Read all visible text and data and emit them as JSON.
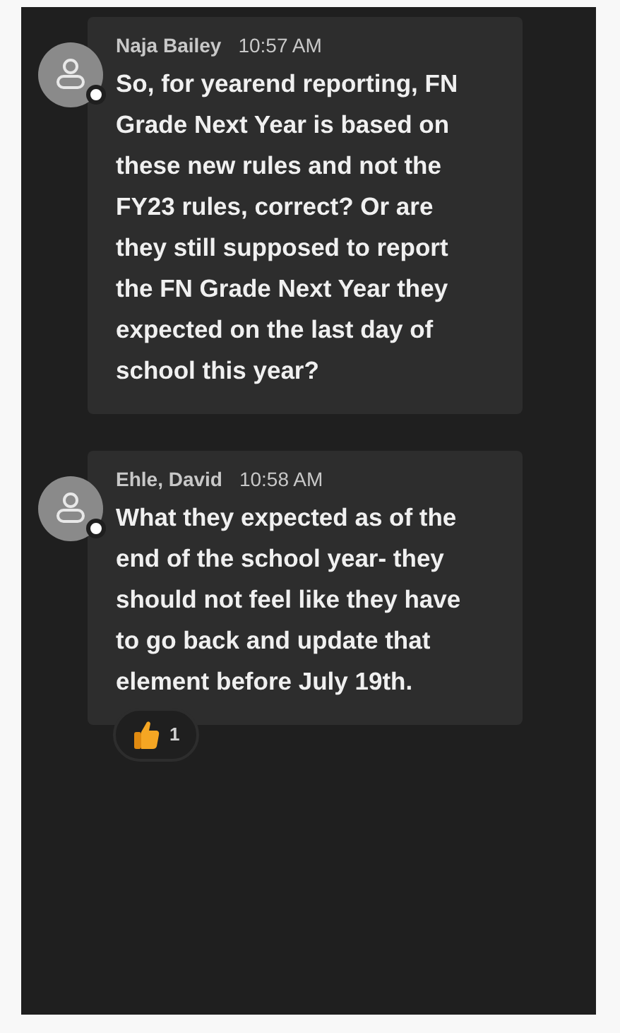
{
  "messages": [
    {
      "author": "Naja Bailey",
      "time": "10:57 AM",
      "text": "So, for yearend reporting, FN Grade Next Year is based on these new rules and not the FY23 rules, correct?  Or are they still supposed to report the FN Grade Next Year they expected on the last day of school this year?"
    },
    {
      "author": "Ehle, David",
      "time": "10:58 AM",
      "text": "What they expected as of the end of the school year- they should not feel like they have to go back and update that element before July 19th.",
      "reactions": [
        {
          "count": "1"
        }
      ]
    }
  ]
}
